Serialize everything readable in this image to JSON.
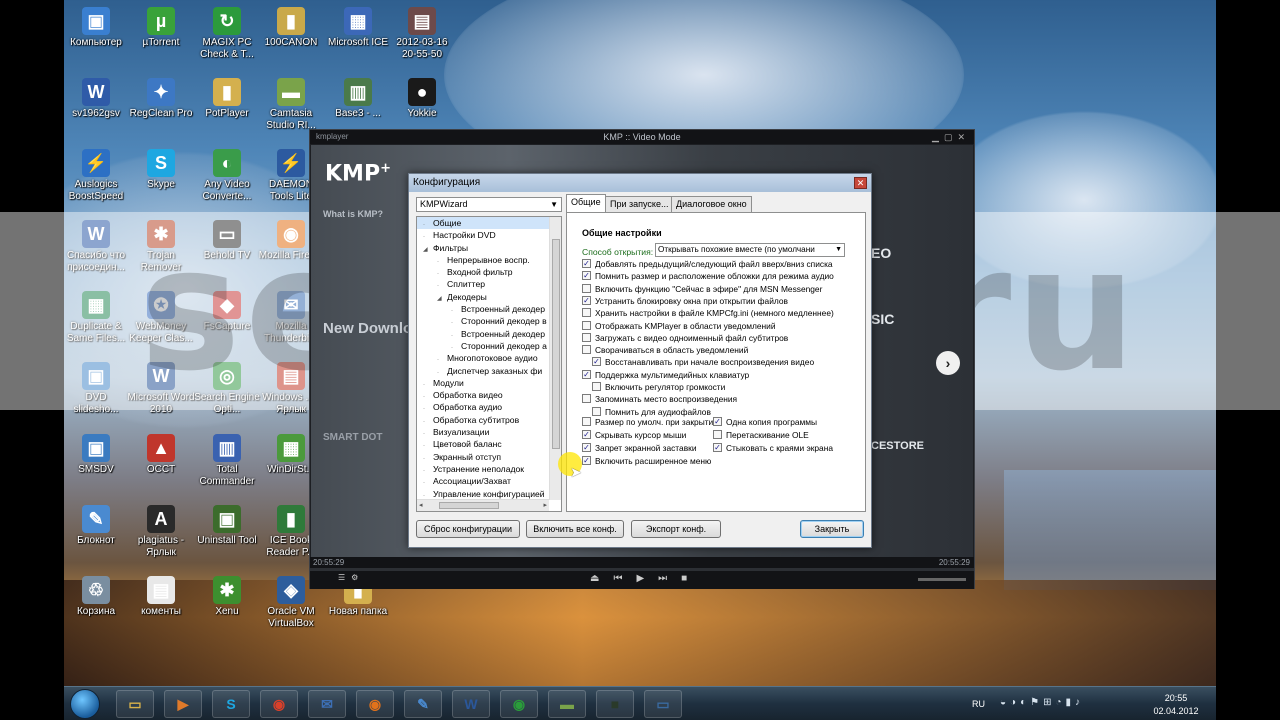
{
  "watermark": "serjsoa.ru",
  "desktop_icons": [
    {
      "label": "Компьютер",
      "icon": "computer-icon",
      "color": "#3a7fd0",
      "glyph": "▣"
    },
    {
      "label": "µTorrent",
      "icon": "utorrent-icon",
      "color": "#39a23a",
      "glyph": "µ"
    },
    {
      "label": "MAGIX PC Check & T...",
      "icon": "magix-icon",
      "color": "#2c9a3c",
      "glyph": "↻"
    },
    {
      "label": "100CANON",
      "icon": "folder-icon",
      "color": "#c9a94a",
      "glyph": "▮"
    },
    {
      "label": "Microsoft ICE",
      "icon": "microsoft-ice-icon",
      "color": "#3c68b8",
      "glyph": "▦"
    },
    {
      "label": "2012-03-16 20-55-50",
      "icon": "video-file-icon",
      "color": "#6d4a4a",
      "glyph": "▤"
    },
    {
      "label": "sv1962gsv",
      "icon": "word-doc-icon",
      "color": "#2f5ba8",
      "glyph": "W"
    },
    {
      "label": "RegClean Pro",
      "icon": "regclean-icon",
      "color": "#3d78c4",
      "glyph": "✦"
    },
    {
      "label": "PotPlayer",
      "icon": "folder-icon",
      "color": "#d4b04e",
      "glyph": "▮"
    },
    {
      "label": "Camtasia Studio RI...",
      "icon": "camtasia-icon",
      "color": "#7aa34a",
      "glyph": "▬"
    },
    {
      "label": "Base3 - ...",
      "icon": "base-icon",
      "color": "#4a7a4a",
      "glyph": "▥"
    },
    {
      "label": "Yokkie",
      "icon": "yokkie-icon",
      "color": "#1a1a1a",
      "glyph": "●"
    },
    {
      "label": "Auslogics BoostSpeed",
      "icon": "auslogics-icon",
      "color": "#2d70c4",
      "glyph": "⚡"
    },
    {
      "label": "Skype",
      "icon": "skype-icon",
      "color": "#1ea7e1",
      "glyph": "S"
    },
    {
      "label": "Any Video Converte...",
      "icon": "video-converter-icon",
      "color": "#3a9c4a",
      "glyph": "◐"
    },
    {
      "label": "DAEMON Tools Lite",
      "icon": "daemon-tools-icon",
      "color": "#2c5aa0",
      "glyph": "⚡"
    },
    {
      "label": "Спасибо что присоедин...",
      "icon": "word-doc-icon",
      "color": "#2f5ba8",
      "glyph": "W"
    },
    {
      "label": "Trojan Remover",
      "icon": "trojan-remover-icon",
      "color": "#b84a2c",
      "glyph": "✱"
    },
    {
      "label": "Behold TV",
      "icon": "behold-tv-icon",
      "color": "#333333",
      "glyph": "▭"
    },
    {
      "label": "Mozilla Firefox",
      "icon": "firefox-icon",
      "color": "#e2721b",
      "glyph": "◉"
    },
    {
      "label": "Duplicate & Same Files...",
      "icon": "duplicate-icon",
      "color": "#2b8a5a",
      "glyph": "▦"
    },
    {
      "label": "WebMoney Keeper Clas...",
      "icon": "webmoney-icon",
      "color": "#3c6fbf",
      "glyph": "✪"
    },
    {
      "label": "FsCapture",
      "icon": "fscapture-icon",
      "color": "#c83c3c",
      "glyph": "◆"
    },
    {
      "label": "Mozilla Thunderbird",
      "icon": "thunderbird-icon",
      "color": "#3d6fb5",
      "glyph": "✉"
    },
    {
      "label": "DVD slidesho...",
      "icon": "dvd-slideshow-icon",
      "color": "#4a8acb",
      "glyph": "▣"
    },
    {
      "label": "Microsoft Word 2010",
      "icon": "word-icon",
      "color": "#2b579a",
      "glyph": "W"
    },
    {
      "label": "Search Engine Opti...",
      "icon": "seo-icon",
      "color": "#3a9b4a",
      "glyph": "◎"
    },
    {
      "label": "Windows ... - Ярлык",
      "icon": "pdf-icon",
      "color": "#c43c2c",
      "glyph": "▤"
    },
    {
      "label": "SMSDV",
      "icon": "smsdv-icon",
      "color": "#3b7bc0",
      "glyph": "▣"
    },
    {
      "label": "OCCT",
      "icon": "occt-icon",
      "color": "#c0362c",
      "glyph": "▲"
    },
    {
      "label": "Total Commander",
      "icon": "total-commander-icon",
      "color": "#3a62b0",
      "glyph": "▥"
    },
    {
      "label": "WinDirSt...",
      "icon": "windirstat-icon",
      "color": "#4b9a3c",
      "glyph": "▦"
    },
    {
      "label": "Блокнот",
      "icon": "notepad-icon",
      "color": "#4a8ad0",
      "glyph": "✎"
    },
    {
      "label": "plagiatus - Ярлык",
      "icon": "plagiatus-icon",
      "color": "#2a2a2a",
      "glyph": "A"
    },
    {
      "label": "Uninstall Tool",
      "icon": "uninstall-tool-icon",
      "color": "#3c6c2c",
      "glyph": "▣"
    },
    {
      "label": "ICE Book Reader P...",
      "icon": "ice-book-reader-icon",
      "color": "#2f7a3a",
      "glyph": "▮"
    },
    {
      "label": "Корзина",
      "icon": "recycle-bin-icon",
      "color": "#7a8ea0",
      "glyph": "♲"
    },
    {
      "label": "коменты",
      "icon": "text-file-icon",
      "color": "#e8e8e8",
      "glyph": "▤"
    },
    {
      "label": "Xenu",
      "icon": "xenu-icon",
      "color": "#3d8f2f",
      "glyph": "✱"
    },
    {
      "label": "Oracle VM VirtualBox",
      "icon": "virtualbox-icon",
      "color": "#2d5d9c",
      "glyph": "◈"
    },
    {
      "label": "Новая папка",
      "icon": "folder-icon",
      "color": "#d4b04e",
      "glyph": "▮"
    }
  ],
  "kmp": {
    "title": "KMP :: Video Mode",
    "app_label": "kmplayer",
    "logo": "KMP",
    "logo_plus": "+",
    "time_left": "20:55:29",
    "time_right": "20:55:29",
    "side_text": "What is KMP?",
    "download_text": "New Download",
    "smart_text": "SMART DOT",
    "right_text_1": "EO",
    "right_text_2": "SIC",
    "right_text_3": "CESTORE"
  },
  "config": {
    "title": "Конфигурация",
    "profile": "KMPWizard",
    "tree": [
      {
        "label": "Общие",
        "indent": 0,
        "expander": "",
        "selected": true
      },
      {
        "label": "Настройки DVD",
        "indent": 0,
        "expander": ""
      },
      {
        "label": "Фильтры",
        "indent": 0,
        "expander": "◢"
      },
      {
        "label": "Непрерывное воспр.",
        "indent": 1,
        "expander": ""
      },
      {
        "label": "Входной фильтр",
        "indent": 1,
        "expander": ""
      },
      {
        "label": "Сплиттер",
        "indent": 1,
        "expander": ""
      },
      {
        "label": "Декодеры",
        "indent": 1,
        "expander": "◢"
      },
      {
        "label": "Встроенный декодер",
        "indent": 2,
        "expander": ""
      },
      {
        "label": "Сторонний декодер в",
        "indent": 2,
        "expander": ""
      },
      {
        "label": "Встроенный декодер",
        "indent": 2,
        "expander": ""
      },
      {
        "label": "Сторонний декодер а",
        "indent": 2,
        "expander": ""
      },
      {
        "label": "Многопотоковое аудио",
        "indent": 1,
        "expander": ""
      },
      {
        "label": "Диспетчер заказных фи",
        "indent": 1,
        "expander": ""
      },
      {
        "label": "Модули",
        "indent": 0,
        "expander": ""
      },
      {
        "label": "Обработка видео",
        "indent": 0,
        "expander": ""
      },
      {
        "label": "Обработка аудио",
        "indent": 0,
        "expander": ""
      },
      {
        "label": "Обработка субтитров",
        "indent": 0,
        "expander": ""
      },
      {
        "label": "Визуализации",
        "indent": 0,
        "expander": ""
      },
      {
        "label": "Цветовой баланс",
        "indent": 0,
        "expander": ""
      },
      {
        "label": "Экранный отступ",
        "indent": 0,
        "expander": ""
      },
      {
        "label": "Устранение неполадок",
        "indent": 0,
        "expander": ""
      },
      {
        "label": "Ассоциации/Захват",
        "indent": 0,
        "expander": ""
      },
      {
        "label": "Управление конфигурацией",
        "indent": 0,
        "expander": ""
      }
    ],
    "tabs": [
      "Общие",
      "При запуске...",
      "Диалоговое окно"
    ],
    "group_title": "Общие настройки",
    "open_label": "Способ открытия:",
    "open_value": "Открывать похожие вместе (по умолчани",
    "options": [
      {
        "label": "Добавлять предыдущий/следующий файл вверх/вниз списка",
        "checked": true
      },
      {
        "label": "Помнить размер и расположение обложки для режима аудио",
        "checked": true
      },
      {
        "label": "Включить функцию \"Сейчас в эфире\" для MSN Messenger",
        "checked": false
      },
      {
        "label": "Устранить блокировку окна при открытии файлов",
        "checked": true
      },
      {
        "label": "Хранить настройки в файле KMPCfg.ini (немного медленнее)",
        "checked": false
      },
      {
        "label": "Отображать KMPlayer в области уведомлений",
        "checked": false
      },
      {
        "label": "Загружать с видео одноименный файл субтитров",
        "checked": false
      },
      {
        "label": "Сворачиваться в область уведомлений",
        "checked": false
      },
      {
        "label": "Восстанавливать при начале воспроизведения видео",
        "checked": true,
        "sub": true
      },
      {
        "label": "Поддержка мультимедийных клавиатур",
        "checked": true
      },
      {
        "label": "Включить регулятор громкости",
        "checked": false,
        "sub": true
      },
      {
        "label": "Запоминать место воспроизведения",
        "checked": false
      },
      {
        "label": "Помнить для аудиофайлов",
        "checked": false,
        "sub": true
      }
    ],
    "options_left": [
      {
        "label": "Размер по умолч. при закрытии",
        "checked": false
      },
      {
        "label": "Скрывать курсор мыши",
        "checked": true
      },
      {
        "label": "Запрет экранной заставки",
        "checked": true
      },
      {
        "label": "Включить расширенное меню",
        "checked": true
      }
    ],
    "options_right": [
      {
        "label": "Одна копия программы",
        "checked": true
      },
      {
        "label": "Перетаскивание OLE",
        "checked": false
      },
      {
        "label": "Стыковать с краями экрана",
        "checked": true
      }
    ],
    "buttons": {
      "reset": "Сброс конфигурации",
      "enable_all": "Включить все конф.",
      "export": "Экспорт конф.",
      "close": "Закрыть"
    }
  },
  "taskbar": {
    "apps": [
      {
        "icon": "explorer-icon",
        "glyph": "▭",
        "color": "#d9b24a"
      },
      {
        "icon": "media-player-icon",
        "glyph": "▶",
        "color": "#e07a2a"
      },
      {
        "icon": "skype-icon",
        "glyph": "S",
        "color": "#1ea7e1"
      },
      {
        "icon": "chrome-icon",
        "glyph": "◉",
        "color": "#d9402a"
      },
      {
        "icon": "thunderbird-icon",
        "glyph": "✉",
        "color": "#3d6fb5"
      },
      {
        "icon": "firefox-icon",
        "glyph": "◉",
        "color": "#e2721b"
      },
      {
        "icon": "paint-icon",
        "glyph": "✎",
        "color": "#4a8ad0"
      },
      {
        "icon": "word-icon",
        "glyph": "W",
        "color": "#2b579a"
      },
      {
        "icon": "chrome-icon",
        "glyph": "◉",
        "color": "#2a9d3a"
      },
      {
        "icon": "camtasia-icon",
        "glyph": "▬",
        "color": "#7aa34a"
      },
      {
        "icon": "camera-icon",
        "glyph": "■",
        "color": "#2a3a2a"
      },
      {
        "icon": "monitor-icon",
        "glyph": "▭",
        "color": "#3a6aa0"
      }
    ],
    "lang": "RU",
    "time": "20:55",
    "date": "02.04.2012"
  }
}
